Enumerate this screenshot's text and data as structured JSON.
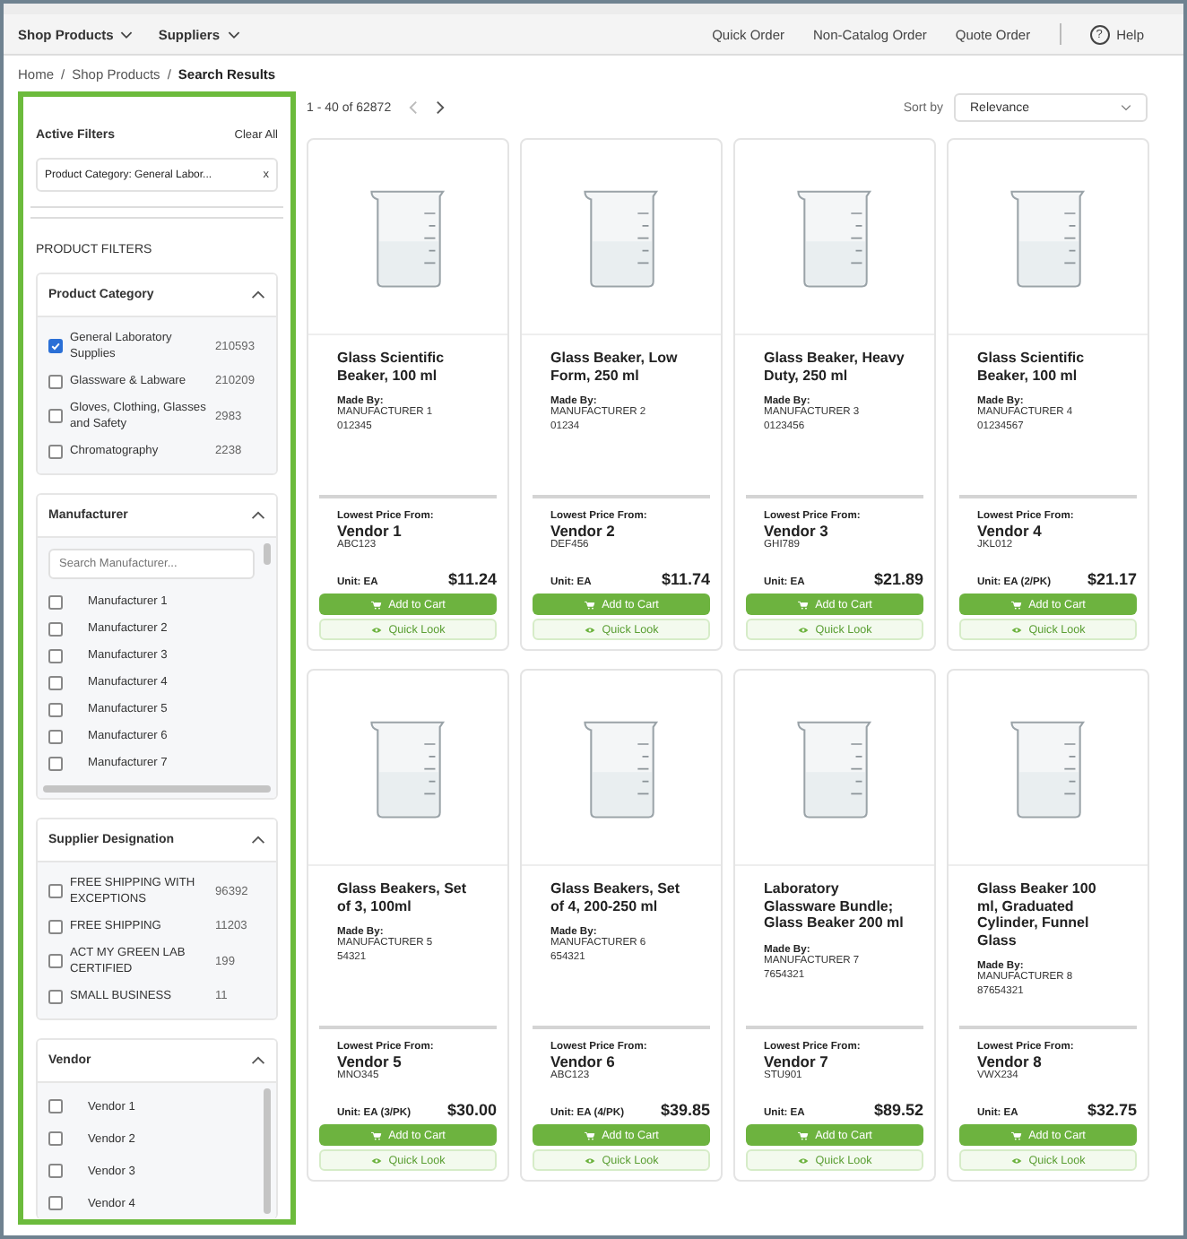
{
  "nav": {
    "left": [
      {
        "label": "Shop Products"
      },
      {
        "label": "Suppliers"
      }
    ],
    "right": [
      {
        "label": "Quick Order"
      },
      {
        "label": "Non-Catalog Order"
      },
      {
        "label": "Quote Order"
      }
    ],
    "help": {
      "glyph": "?",
      "label": "Help"
    }
  },
  "breadcrumb": {
    "separator": "/",
    "items": [
      "Home",
      "Shop Products",
      "Search Results"
    ]
  },
  "active_filters": {
    "title": "Active Filters",
    "clear": "Clear All",
    "chips": [
      {
        "label": "Product Category: General Labor...",
        "remove": "x"
      }
    ]
  },
  "product_filters_title": "PRODUCT FILTERS",
  "sections": [
    {
      "title": "Product Category",
      "expanded": true,
      "kind": "counted",
      "options": [
        {
          "label": "General Laboratory Supplies",
          "count": "210593",
          "checked": true
        },
        {
          "label": "Glassware & Labware",
          "count": "210209",
          "checked": false
        },
        {
          "label": "Gloves, Clothing, Glasses and Safety",
          "count": "2983",
          "checked": false
        },
        {
          "label": "Chromatography",
          "count": "2238",
          "checked": false
        }
      ]
    },
    {
      "title": "Manufacturer",
      "expanded": true,
      "kind": "search_list",
      "search_placeholder": "Search Manufacturer...",
      "options": [
        {
          "label": "Manufacturer 1",
          "checked": false
        },
        {
          "label": "Manufacturer 2",
          "checked": false
        },
        {
          "label": "Manufacturer 3",
          "checked": false
        },
        {
          "label": "Manufacturer 4",
          "checked": false
        },
        {
          "label": "Manufacturer 5",
          "checked": false
        },
        {
          "label": "Manufacturer 6",
          "checked": false
        },
        {
          "label": "Manufacturer 7",
          "checked": false
        }
      ]
    },
    {
      "title": "Supplier Designation",
      "expanded": true,
      "kind": "counted",
      "options": [
        {
          "label": "FREE SHIPPING WITH EXCEPTIONS",
          "count": "96392",
          "checked": false
        },
        {
          "label": "FREE SHIPPING",
          "count": "11203",
          "checked": false
        },
        {
          "label": "ACT MY GREEN LAB CERTIFIED",
          "count": "199",
          "checked": false
        },
        {
          "label": "SMALL BUSINESS",
          "count": "11",
          "checked": false
        }
      ]
    },
    {
      "title": "Vendor",
      "expanded": true,
      "kind": "list",
      "options": [
        {
          "label": "Vendor 1",
          "checked": false
        },
        {
          "label": "Vendor 2",
          "checked": false
        },
        {
          "label": "Vendor 3",
          "checked": false
        },
        {
          "label": "Vendor 4",
          "checked": false
        }
      ]
    }
  ],
  "results": {
    "range": "1 - 40 of 62872",
    "sort_label": "Sort by",
    "sort_value": "Relevance"
  },
  "products": [
    {
      "name": "Glass Scientific Beaker, 100 ml",
      "made_by": "Made By:",
      "manufacturer": "MANUFACTURER 1",
      "part": "012345",
      "price_from": "Lowest Price From:",
      "vendor": "Vendor 1",
      "vendor_code": "ABC123",
      "unit": "Unit: EA",
      "price": "$11.24",
      "add": "Add to Cart",
      "quick": "Quick Look"
    },
    {
      "name": "Glass Beaker, Low Form, 250 ml",
      "made_by": "Made By:",
      "manufacturer": "MANUFACTURER 2",
      "part": "01234",
      "price_from": "Lowest Price From:",
      "vendor": "Vendor 2",
      "vendor_code": "DEF456",
      "unit": "Unit: EA",
      "price": "$11.74",
      "add": "Add to Cart",
      "quick": "Quick Look"
    },
    {
      "name": "Glass Beaker, Heavy Duty, 250 ml",
      "made_by": "Made By:",
      "manufacturer": "MANUFACTURER 3",
      "part": "0123456",
      "price_from": "Lowest Price From:",
      "vendor": "Vendor 3",
      "vendor_code": "GHI789",
      "unit": "Unit: EA",
      "price": "$21.89",
      "add": "Add to Cart",
      "quick": "Quick Look"
    },
    {
      "name": "Glass Scientific Beaker, 100 ml",
      "made_by": "Made By:",
      "manufacturer": "MANUFACTURER 4",
      "part": "01234567",
      "price_from": "Lowest Price From:",
      "vendor": "Vendor 4",
      "vendor_code": "JKL012",
      "unit": "Unit: EA (2/PK)",
      "price": "$21.17",
      "add": "Add to Cart",
      "quick": "Quick Look"
    },
    {
      "name": "Glass Beakers, Set of 3, 100ml",
      "made_by": "Made By:",
      "manufacturer": "MANUFACTURER 5",
      "part": "54321",
      "price_from": "Lowest Price From:",
      "vendor": "Vendor 5",
      "vendor_code": "MNO345",
      "unit": "Unit: EA (3/PK)",
      "price": "$30.00",
      "add": "Add to Cart",
      "quick": "Quick Look"
    },
    {
      "name": "Glass Beakers, Set of 4, 200-250 ml",
      "made_by": "Made By:",
      "manufacturer": "MANUFACTURER 6",
      "part": "654321",
      "price_from": "Lowest Price From:",
      "vendor": "Vendor 6",
      "vendor_code": "ABC123",
      "unit": "Unit: EA (4/PK)",
      "price": "$39.85",
      "add": "Add to Cart",
      "quick": "Quick Look"
    },
    {
      "name": "Laboratory Glassware Bundle; Glass Beaker 200 ml",
      "made_by": "Made By:",
      "manufacturer": "MANUFACTURER 7",
      "part": "7654321",
      "price_from": "Lowest Price From:",
      "vendor": "Vendor 7",
      "vendor_code": "STU901",
      "unit": "Unit: EA",
      "price": "$89.52",
      "add": "Add to Cart",
      "quick": "Quick Look"
    },
    {
      "name": "Glass Beaker 100 ml, Graduated Cylinder, Funnel Glass",
      "made_by": "Made By:",
      "manufacturer": "MANUFACTURER 8",
      "part": "87654321",
      "price_from": "Lowest Price From:",
      "vendor": "Vendor 8",
      "vendor_code": "VWX234",
      "unit": "Unit: EA",
      "price": "$32.75",
      "add": "Add to Cart",
      "quick": "Quick Look"
    }
  ]
}
